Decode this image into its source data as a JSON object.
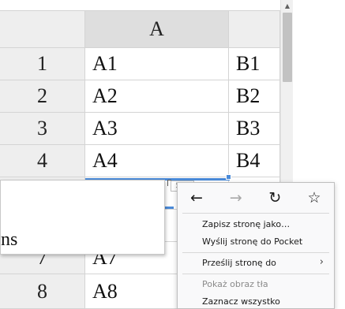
{
  "sheet": {
    "column_headers": [
      "A",
      ""
    ],
    "row_numbers": [
      "1",
      "2",
      "3",
      "4",
      "",
      "",
      "7",
      "8"
    ],
    "col_a": [
      "A1",
      "A2",
      "A3",
      "A4",
      "",
      "",
      "A7",
      "A8"
    ],
    "col_b": [
      "B1",
      "B2",
      "B3",
      "B4",
      "",
      "",
      "",
      ""
    ]
  },
  "tooltip": {
    "size_text": "5px"
  },
  "popup": {
    "fragment_text": "ns"
  },
  "context_menu": {
    "nav": {
      "back_glyph": "←",
      "forward_glyph": "→",
      "reload_glyph": "↻",
      "bookmark_glyph": "☆"
    },
    "items": {
      "save_page": "Zapisz stronę jako…",
      "send_pocket": "Wyślij stronę do Pocket",
      "send_page_to": "Prześlij stronę do",
      "submenu_arrow": "›",
      "show_alt": "Pokaż obraz tła",
      "select_all": "Zaznacz wszystko"
    }
  },
  "scrollbar": {
    "up_arrow_glyph": "▲"
  }
}
